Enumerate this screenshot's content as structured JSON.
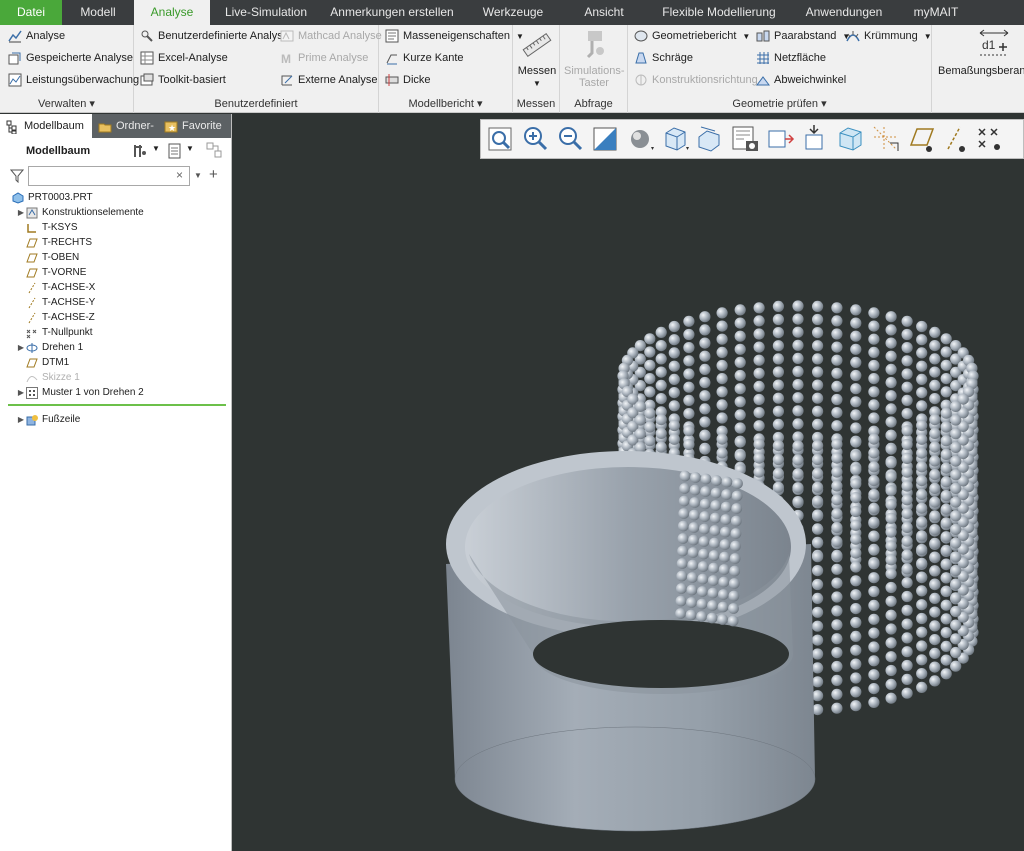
{
  "menubar": {
    "tabs": [
      "Datei",
      "Modell",
      "Analyse",
      "Live-Simulation",
      "Anmerkungen erstellen",
      "Werkzeuge",
      "Ansicht",
      "Flexible Modellierung",
      "Anwendungen",
      "myMAIT"
    ],
    "active": "Analyse"
  },
  "ribbon": {
    "verwalten": {
      "label": "Verwalten",
      "items": [
        "Analyse",
        "Gespeicherte Analyse",
        "Leistungsüberwachung"
      ]
    },
    "benutzerdefiniert": {
      "label": "Benutzerdefiniert",
      "col1": [
        "Benutzerdefinierte Analyse",
        "Excel-Analyse",
        "Toolkit-basiert"
      ],
      "col2": [
        "Mathcad Analyse",
        "Prime Analyse",
        "Externe Analyse"
      ]
    },
    "modellbericht": {
      "label": "Modellbericht",
      "items": [
        "Masseneigenschaften",
        "Kurze Kante",
        "Dicke"
      ]
    },
    "messen": {
      "label": "Messen",
      "button": "Messen"
    },
    "abfrage": {
      "label": "Abfrage",
      "button_line1": "Simulations-",
      "button_line2": "Taster"
    },
    "geometrie": {
      "label": "Geometrie prüfen",
      "col1": [
        "Geometriebericht",
        "Schräge",
        "Konstruktionsrichtung"
      ],
      "col2": [
        "Paarabstand",
        "Netzfläche",
        "Abweichwinkel"
      ],
      "col3": [
        "Krümmung"
      ]
    },
    "bemassung": {
      "icon_text": "d1",
      "label": "Bemaßungsberandu"
    }
  },
  "panel": {
    "tabs": [
      "Modellbaum",
      "Ordner-",
      "Favorite"
    ],
    "header": "Modellbaum",
    "filter_value": "",
    "tree": [
      {
        "label": "PRT0003.PRT",
        "icon": "part-icon",
        "indent": 0,
        "arrow": false
      },
      {
        "label": "Konstruktionselemente",
        "icon": "features-icon",
        "indent": 1,
        "arrow": true
      },
      {
        "label": "T-KSYS",
        "icon": "csys-icon",
        "indent": 1,
        "arrow": false
      },
      {
        "label": "T-RECHTS",
        "icon": "plane-icon",
        "indent": 1,
        "arrow": false
      },
      {
        "label": "T-OBEN",
        "icon": "plane-icon",
        "indent": 1,
        "arrow": false
      },
      {
        "label": "T-VORNE",
        "icon": "plane-icon",
        "indent": 1,
        "arrow": false
      },
      {
        "label": "T-ACHSE-X",
        "icon": "axis-icon",
        "indent": 1,
        "arrow": false
      },
      {
        "label": "T-ACHSE-Y",
        "icon": "axis-icon",
        "indent": 1,
        "arrow": false
      },
      {
        "label": "T-ACHSE-Z",
        "icon": "axis-icon",
        "indent": 1,
        "arrow": false
      },
      {
        "label": "T-Nullpunkt",
        "icon": "point-icon",
        "indent": 1,
        "arrow": false
      },
      {
        "label": "Drehen 1",
        "icon": "revolve-icon",
        "indent": 1,
        "arrow": true
      },
      {
        "label": "DTM1",
        "icon": "plane-icon",
        "indent": 1,
        "arrow": false
      },
      {
        "label": "Skizze 1",
        "icon": "sketch-icon",
        "indent": 1,
        "arrow": false,
        "disabled": true
      },
      {
        "label": "Muster 1 von Drehen 2",
        "icon": "pattern-icon",
        "indent": 1,
        "arrow": true
      }
    ],
    "footer": "Fußzeile"
  },
  "colors": {
    "accent": "#4aa83a",
    "viewport_bg": "#2f3433",
    "model": "#9aa3ad"
  }
}
